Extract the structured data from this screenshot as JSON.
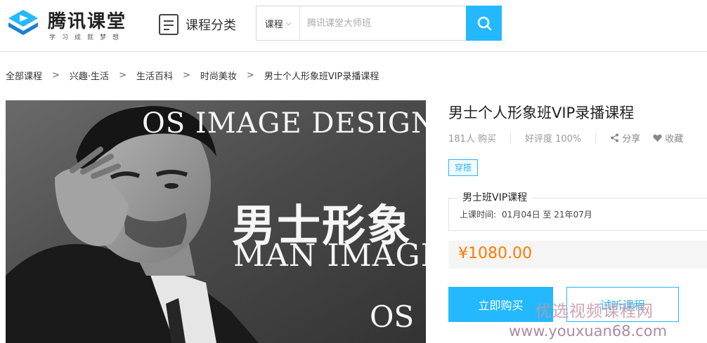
{
  "header": {
    "logo_text": "腾讯课堂",
    "logo_slogan": "学习成就梦想",
    "category_label": "课程分类",
    "search_type": "课程",
    "search_placeholder": "腾讯课堂大师班"
  },
  "breadcrumb": [
    "全部课程",
    "兴趣·生活",
    "生活百科",
    "时尚美妆",
    "男士个人形象班VIP录播课程"
  ],
  "banner": {
    "line1": "OS IMAGE DESIGN",
    "line2": "男士形象",
    "line3": "MAN IMAGE",
    "line4": "OS"
  },
  "course": {
    "title": "男士个人形象班VIP录播课程",
    "buyers": "181人 购买",
    "rating": "好评度 100%",
    "share_label": "分享",
    "favorite_label": "收藏",
    "tag": "穿搭",
    "class_name": "男士班VIP课程",
    "time_label": "上课时间:",
    "time_value": "01月04日 至 21年07月",
    "price": "¥1080.00",
    "buy_label": "立即购买",
    "trial_label": "试听课程"
  },
  "watermark": {
    "line1": "优选视频课程网",
    "line2": "www.youxuan68.com"
  },
  "colors": {
    "accent": "#23b8ff",
    "price": "#ff7a00"
  },
  "icons": [
    "logo-play-icon",
    "category-list-icon",
    "chevron-down-icon",
    "search-icon",
    "breadcrumb-chevron-icon",
    "share-icon",
    "heart-icon"
  ]
}
